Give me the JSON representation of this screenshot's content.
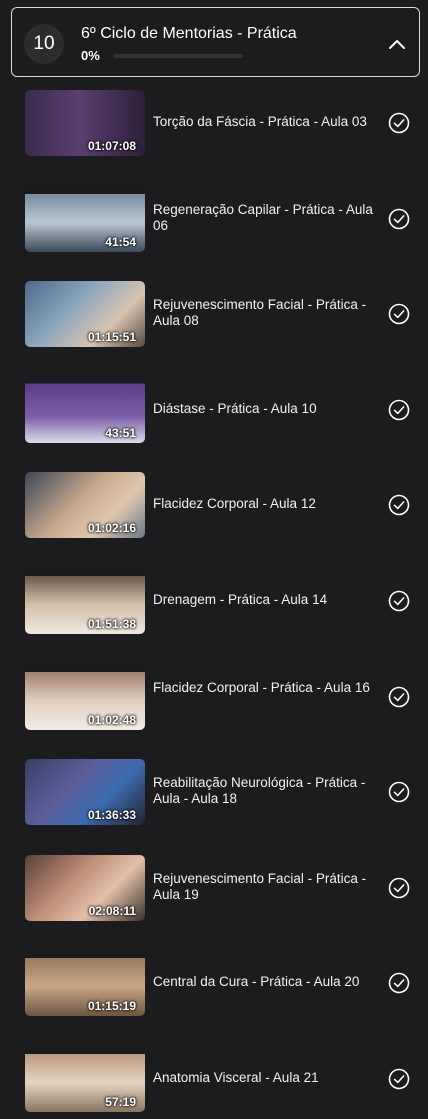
{
  "module": {
    "number": "10",
    "title": "6º Ciclo de Mentorias - Prática",
    "progress_label": "0%",
    "progress_value": 0
  },
  "lessons": [
    {
      "title": "Torção da Fáscia - Prática - Aula 03",
      "duration": "01:07:08",
      "completed_icon": "check-circle-icon"
    },
    {
      "title": "Regeneração Capilar - Prática - Aula 06",
      "duration": "41:54",
      "completed_icon": "check-circle-icon"
    },
    {
      "title": "Rejuvenescimento Facial - Prática - Aula 08",
      "duration": "01:15:51",
      "completed_icon": "check-circle-icon"
    },
    {
      "title": "Diástase - Prática - Aula 10",
      "duration": "43:51",
      "completed_icon": "check-circle-icon"
    },
    {
      "title": "Flacidez Corporal - Aula 12",
      "duration": "01:02:16",
      "completed_icon": "check-circle-icon"
    },
    {
      "title": "Drenagem - Prática - Aula 14",
      "duration": "01:51:38",
      "completed_icon": "check-circle-icon"
    },
    {
      "title": "Flacidez Corporal - Prática - Aula 16",
      "duration": "01:02:48",
      "completed_icon": "check-circle-icon"
    },
    {
      "title": "Reabilitação Neurológica - Prática - Aula - Aula 18",
      "duration": "01:36:33",
      "completed_icon": "check-circle-icon"
    },
    {
      "title": "Rejuvenescimento Facial - Prática - Aula 19",
      "duration": "02:08:11",
      "completed_icon": "check-circle-icon"
    },
    {
      "title": "Central da Cura - Prática - Aula 20",
      "duration": "01:15:19",
      "completed_icon": "check-circle-icon"
    },
    {
      "title": "Anatomia Visceral - Aula 21",
      "duration": "57:19",
      "completed_icon": "check-circle-icon"
    }
  ]
}
